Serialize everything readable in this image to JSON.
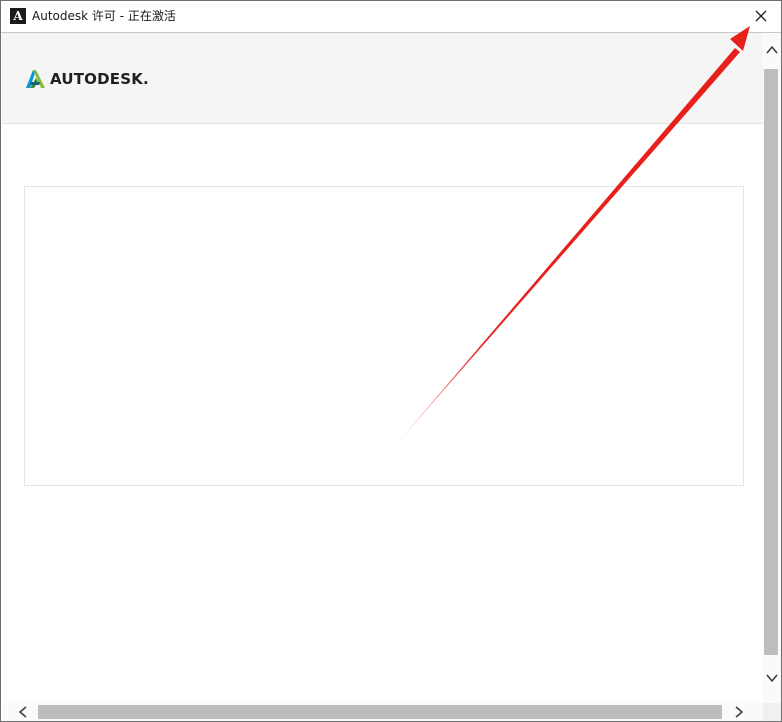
{
  "window": {
    "title": "Autodesk 许可 - 正在激活",
    "app_icon_glyph": "A"
  },
  "header": {
    "logo_text": "AUTODESK."
  },
  "annotation": {
    "color": "#e8201c",
    "points_to": "close-button"
  }
}
